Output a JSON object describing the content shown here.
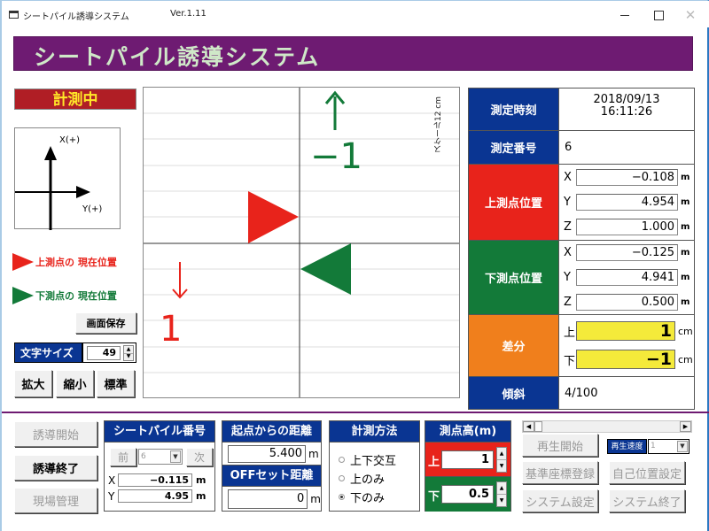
{
  "window": {
    "title": "シートパイル誘導システム",
    "version": "Ver.1.11",
    "minimize_label": "",
    "close_label": "✕"
  },
  "banner": {
    "title": "シートパイル誘導システム"
  },
  "left_panel": {
    "status": "計測中",
    "axis_diagram": {
      "x_label": "X(+)",
      "y_label": "Y(+)"
    },
    "legend": {
      "upper": "上測点の 現在位置",
      "lower": "下測点の 現在位置"
    },
    "save_button": "画面保存",
    "font_size": {
      "label": "文字サイズ",
      "value": "49",
      "up": "▲",
      "down": "▼"
    },
    "zoom_buttons": {
      "zoom_in": "拡大",
      "zoom_out": "縮小",
      "standard": "標準"
    }
  },
  "plot": {
    "scale_label": "スケール12 cm",
    "upper_arrow": "↑",
    "upper_value": "−1",
    "lower_arrow": "↓",
    "lower_value": "1",
    "colors": {
      "upper": "#e8231b",
      "lower": "#137a39"
    }
  },
  "info": {
    "measure_time": {
      "label": "測定時刻",
      "date": "2018/09/13",
      "time": "16:11:26"
    },
    "measure_no": {
      "label": "測定番号",
      "value": "6"
    },
    "upper_pos": {
      "label": "上測点位置",
      "x": "−0.108",
      "y": "4.954",
      "z": "1.000",
      "unit": "m",
      "x_name": "X",
      "y_name": "Y",
      "z_name": "Z"
    },
    "lower_pos": {
      "label": "下測点位置",
      "x": "−0.125",
      "y": "4.941",
      "z": "0.500",
      "unit": "m",
      "x_name": "X",
      "y_name": "Y",
      "z_name": "Z"
    },
    "diff": {
      "label": "差分",
      "upper_name": "上",
      "upper": "1",
      "lower_name": "下",
      "lower": "−1",
      "unit": "cm"
    },
    "tilt": {
      "label": "傾斜",
      "value": "4/100"
    }
  },
  "bottom": {
    "side_buttons": {
      "start": "誘導開始",
      "end": "誘導終了",
      "site": "現場管理"
    },
    "sheet_pile": {
      "title": "シートパイル番号",
      "prev": "前",
      "next": "次",
      "selected": "6",
      "x_name": "X",
      "x": "−0.115",
      "y_name": "Y",
      "y": "4.95",
      "unit": "m"
    },
    "distance": {
      "title": "起点からの距離",
      "value": "5.400",
      "unit": "m",
      "offset_title": "OFFセット距離",
      "offset_value": "0",
      "offset_unit": "m"
    },
    "method": {
      "title": "計測方法",
      "options": [
        {
          "label": "上下交互",
          "checked": false
        },
        {
          "label": "上のみ",
          "checked": false
        },
        {
          "label": "下のみ",
          "checked": true
        }
      ]
    },
    "point_height": {
      "title": "測点高(m)",
      "upper_name": "上",
      "upper": "1",
      "lower_name": "下",
      "lower": "0.5"
    },
    "playback": {
      "start": "再生開始",
      "speed_label": "再生速度",
      "speed_value": "1",
      "scroll_left": "◀",
      "scroll_right": "▶"
    },
    "buttons": {
      "ref_register": "基準座標登録",
      "self_pos": "自己位置設定",
      "sys_setting": "システム設定",
      "sys_exit": "システム終了"
    }
  }
}
